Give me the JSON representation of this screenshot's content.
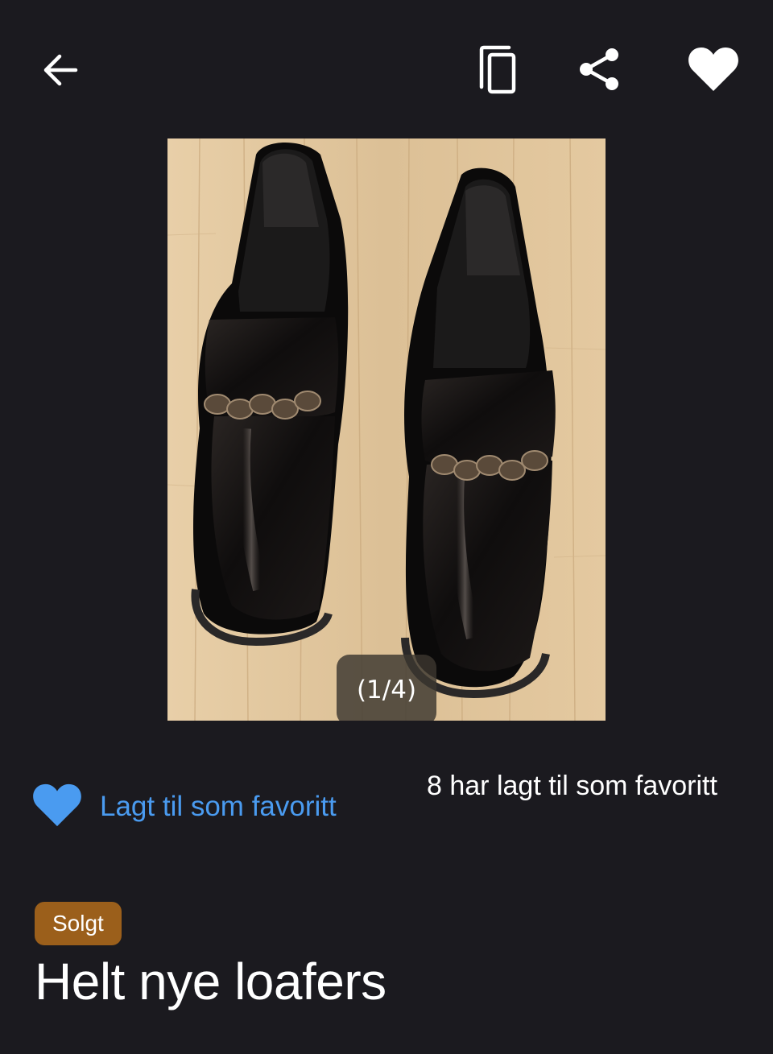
{
  "header": {
    "back_icon": "arrow-left-icon",
    "copy_icon": "copy-icon",
    "share_icon": "share-icon",
    "favorite_icon": "heart-filled-icon"
  },
  "gallery": {
    "counter": "(1/4)"
  },
  "favorite": {
    "icon": "heart-filled-icon",
    "label": "Lagt til som favoritt",
    "count_text": "8 har lagt til som favoritt"
  },
  "listing": {
    "status_badge": "Solgt",
    "title": "Helt nye loafers"
  },
  "colors": {
    "background": "#1b1a1f",
    "accent_blue": "#4a9bf0",
    "badge_brown": "#9b5f1b",
    "text": "#ffffff"
  }
}
